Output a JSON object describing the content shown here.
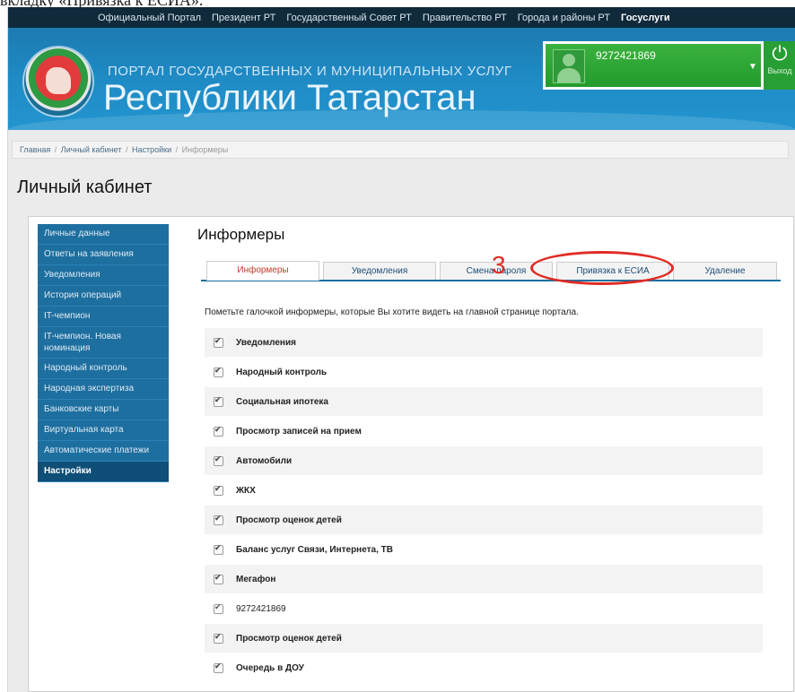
{
  "clipped_caption": "вкладку «Привязка к ЕСИА».",
  "topnav": [
    "Официальный Портал",
    "Президент РТ",
    "Государственный Совет РТ",
    "Правительство РТ",
    "Города и районы РТ",
    "Госуслуги"
  ],
  "banner": {
    "line1": "ПОРТАЛ ГОСУДАРСТВЕННЫХ И МУНИЦИПАЛЬНЫХ УСЛУГ",
    "line2": "Республики Татарстан",
    "user_phone": "9272421869",
    "exit_label": "Выход"
  },
  "breadcrumbs": [
    "Главная",
    "Личный кабинет",
    "Настройки",
    "Информеры"
  ],
  "page_title": "Личный кабинет",
  "sidebar": [
    "Личные данные",
    "Ответы на заявления",
    "Уведомления",
    "История операций",
    "IT-чемпион",
    "IT-чемпион. Новая номинация",
    "Народный контроль",
    "Народная экспертиза",
    "Банковские карты",
    "Виртуальная карта",
    "Автоматические платежи",
    "Настройки"
  ],
  "content_title": "Информеры",
  "tabs": [
    "Информеры",
    "Уведомления",
    "Смена пароля",
    "Привязка к ЕСИА",
    "Удаление"
  ],
  "annotation_number": "3",
  "hint": "Пометьте галочкой информеры, которые Вы хотите видеть на главной странице портала.",
  "informers": [
    "Уведомления",
    "Народный контроль",
    "Социальная ипотека",
    "Просмотр записей на прием",
    "Автомобили",
    "ЖКХ",
    "Просмотр оценок детей",
    "Баланс услуг Связи, Интернета, ТВ",
    "Мегафон",
    "9272421869",
    "Просмотр оценок детей",
    "Очередь в ДОУ"
  ],
  "colors": {
    "accent_blue": "#1d6fa0",
    "active_tab_text": "#c33a2a",
    "annotation_red": "#e02b24",
    "user_green": "#2aa336"
  }
}
